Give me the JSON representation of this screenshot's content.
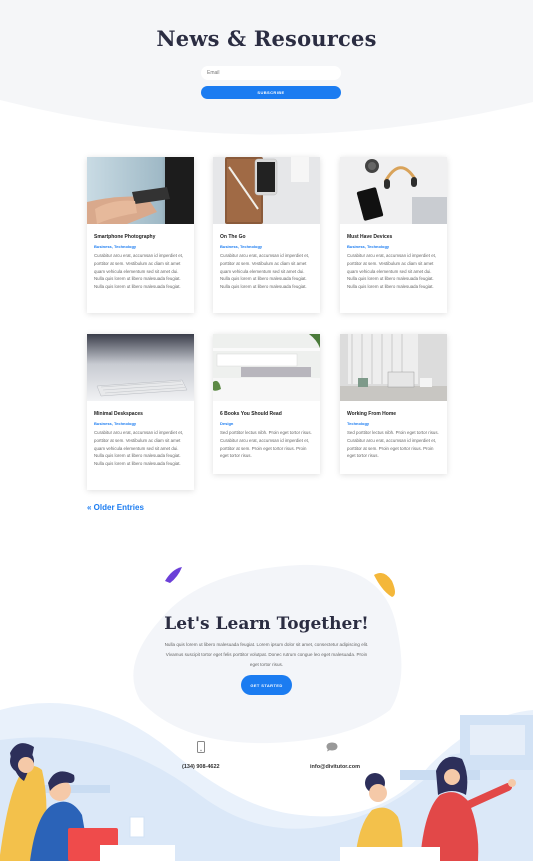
{
  "hero": {
    "title": "News & Resources",
    "email_placeholder": "Email",
    "subscribe_label": "SUBSCRIBE"
  },
  "posts": [
    {
      "title": "Smartphone Photography",
      "categories": "Business, Technology",
      "excerpt": "Curabitur arcu erat, accumsan id imperdiet et, porttitor at sem. Vestibulum ac diam sit amet quam vehicula elementum sed sit amet dui. Nulla quis lorem ut libero malesuada feugiat. Nulla quis lorem ut libero malesuada feugiat."
    },
    {
      "title": "On The Go",
      "categories": "Business, Technology",
      "excerpt": "Curabitur arcu erat, accumsan id imperdiet et, porttitor at sem. Vestibulum ac diam sit amet quam vehicula elementum sed sit amet dui. Nulla quis lorem ut libero malesuada feugiat. Nulla quis lorem ut libero malesuada feugiat."
    },
    {
      "title": "Must Have Devices",
      "categories": "Business, Technology",
      "excerpt": "Curabitur arcu erat, accumsan id imperdiet et, porttitor at sem. Vestibulum ac diam sit amet quam vehicula elementum sed sit amet dui. Nulla quis lorem ut libero malesuada feugiat. Nulla quis lorem ut libero malesuada feugiat."
    },
    {
      "title": "Minimal Deskspaces",
      "categories": "Business, Technology",
      "excerpt": "Curabitur arcu erat, accumsan id imperdiet et, porttitor at sem. Vestibulum ac diam sit amet quam vehicula elementum sed sit amet dui. Nulla quis lorem ut libero malesuada feugiat. Nulla quis lorem ut libero malesuada feugiat."
    },
    {
      "title": "6 Books You Should Read",
      "categories": "Design",
      "excerpt": "Sed porttitor lectus nibh. Proin eget tortor risus. Curabitur arcu erat, accumsan id imperdiet et, porttitor at sem. Proin eget tortor risus. Proin eget tortor risus."
    },
    {
      "title": "Working From Home",
      "categories": "Technology",
      "excerpt": "Sed porttitor lectus nibh. Proin eget tortor risus. Curabitur arcu erat, accumsan id imperdiet et, porttitor at sem. Proin eget tortor risus. Proin eget tortor risus."
    }
  ],
  "older_entries_label": "« Older Entries",
  "cta": {
    "title": "Let's Learn Together!",
    "text": "Nulla quis lorem ut libero malesuada feugiat. Lorem ipsum dolor sit amet, consectetur adipiscing elit. Vivamus suscipit tortor eget felis porttitor volutpat. Donec rutrum congue leo eget malesuada. Proin eget tortor risus.",
    "button_label": "GET STARTED"
  },
  "contact": {
    "phone_icon": "phone-icon",
    "phone": "(134) 908-4622",
    "email_icon": "chat-bubble-icon",
    "email": "info@divitutor.com"
  },
  "colors": {
    "accent": "#1b7cf1",
    "heading": "#2b2d42",
    "hero_bg": "#f5f6f8",
    "purple_blob": "#6b3fd8",
    "yellow_blob": "#f4b73a",
    "illustration_blue": "#dbe8f8"
  }
}
